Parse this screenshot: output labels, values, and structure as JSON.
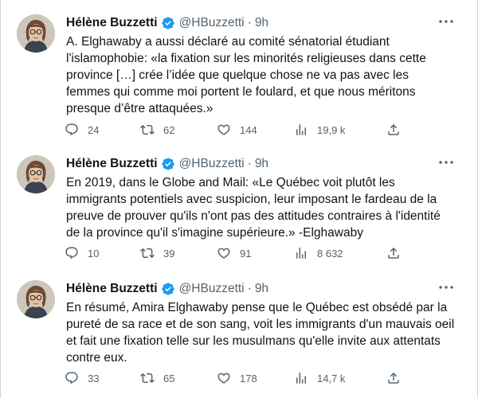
{
  "tweets": [
    {
      "author": {
        "name": "Hélène Buzzetti",
        "handle": "@HBuzzetti",
        "time": "9h"
      },
      "text": "A. Elghawaby a aussi déclaré au comité sénatorial étudiant l'islamophobie: «la fixation sur les minorités religieuses dans cette province […] crée l’idée que quelque chose ne va pas avec les femmes qui comme moi portent le foulard, et que nous méritons presque d’être attaquées.»",
      "stats": {
        "replies": "24",
        "retweets": "62",
        "likes": "144",
        "views": "19,9 k"
      }
    },
    {
      "author": {
        "name": "Hélène Buzzetti",
        "handle": "@HBuzzetti",
        "time": "9h"
      },
      "text": "En 2019, dans le Globe and Mail: «Le Québec voit plutôt les immigrants potentiels avec suspicion, leur imposant le fardeau de la preuve de prouver qu'ils n'ont pas des attitudes contraires à l'identité de la province qu'il s'imagine supérieure.» -Elghawaby",
      "stats": {
        "replies": "10",
        "retweets": "39",
        "likes": "91",
        "views": "8 632"
      }
    },
    {
      "author": {
        "name": "Hélène Buzzetti",
        "handle": "@HBuzzetti",
        "time": "9h"
      },
      "text": "En résumé, Amira Elghawaby pense que le Québec est obsédé par la pureté de sa race et de son sang, voit les immigrants d'un mauvais oeil et fait une fixation telle sur les musulmans qu'elle invite aux attentats contre eux.",
      "stats": {
        "replies": "33",
        "retweets": "65",
        "likes": "178",
        "views": "14,7 k"
      }
    }
  ],
  "colors": {
    "text": "#0f1419",
    "secondary": "#536471",
    "verified": "#1d9bf0"
  },
  "icons": [
    "reply-icon",
    "retweet-icon",
    "like-icon",
    "views-icon",
    "share-icon",
    "more-icon",
    "verified-badge-icon"
  ]
}
